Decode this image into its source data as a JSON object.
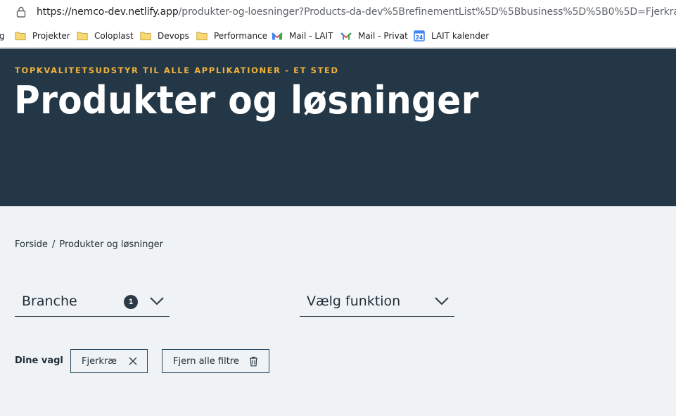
{
  "browser": {
    "url_host": "https://nemco-dev.netlify.app",
    "url_path": "/produkter-og-loesninger?Products-da-dev%5BrefinementList%5D%5Bbusiness%5D%5B0%5D=Fjerkræ",
    "bookmarks": [
      {
        "label": "g",
        "icon": "none"
      },
      {
        "label": "Projekter",
        "icon": "folder-icon"
      },
      {
        "label": "Coloplast",
        "icon": "folder-icon"
      },
      {
        "label": "Devops",
        "icon": "folder-icon"
      },
      {
        "label": "Performance",
        "icon": "folder-icon"
      },
      {
        "label": "Mail - LAIT",
        "icon": "gmail-icon"
      },
      {
        "label": "Mail - Privat",
        "icon": "gmail-icon"
      },
      {
        "label": "LAIT kalender",
        "icon": "calendar-icon",
        "icon_text": "24"
      }
    ]
  },
  "hero": {
    "eyebrow": "TOPKVALITETSUDSTYR TIL ALLE APPLIKATIONER - ET STED",
    "title": "Produkter og løsninger",
    "background": "#233746",
    "eyebrow_color": "#f2b23a"
  },
  "breadcrumb": {
    "items": [
      "Forside",
      "Produkter og løsninger"
    ],
    "separator": "/"
  },
  "filters": {
    "branche": {
      "label": "Branche",
      "count": "1"
    },
    "funktion": {
      "label": "Vælg funktion"
    }
  },
  "chosen": {
    "label": "Dine vagl",
    "chips": [
      {
        "label": "Fjerkræ"
      }
    ],
    "clear_all": "Fjern alle filtre"
  }
}
